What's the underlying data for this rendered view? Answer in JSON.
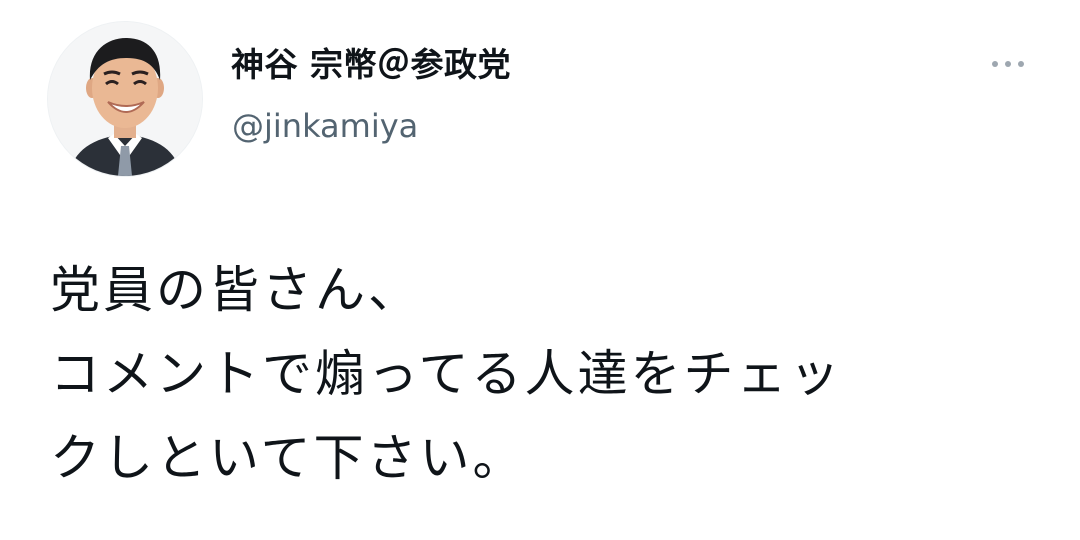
{
  "author": {
    "display_name": "神谷 宗幣＠参政党",
    "handle": "@jinkamiya",
    "avatar_icon": "profile-photo"
  },
  "menu": {
    "icon": "more-horizontal-icon"
  },
  "tweet": {
    "lines": [
      "党員の皆さん、",
      "コメントで煽ってる人達をチェッ",
      "クしといて下さい。"
    ]
  },
  "colors": {
    "text": "#0f1419",
    "secondary": "#536471",
    "menu_dots": "#9ea7b0",
    "background": "#ffffff"
  }
}
